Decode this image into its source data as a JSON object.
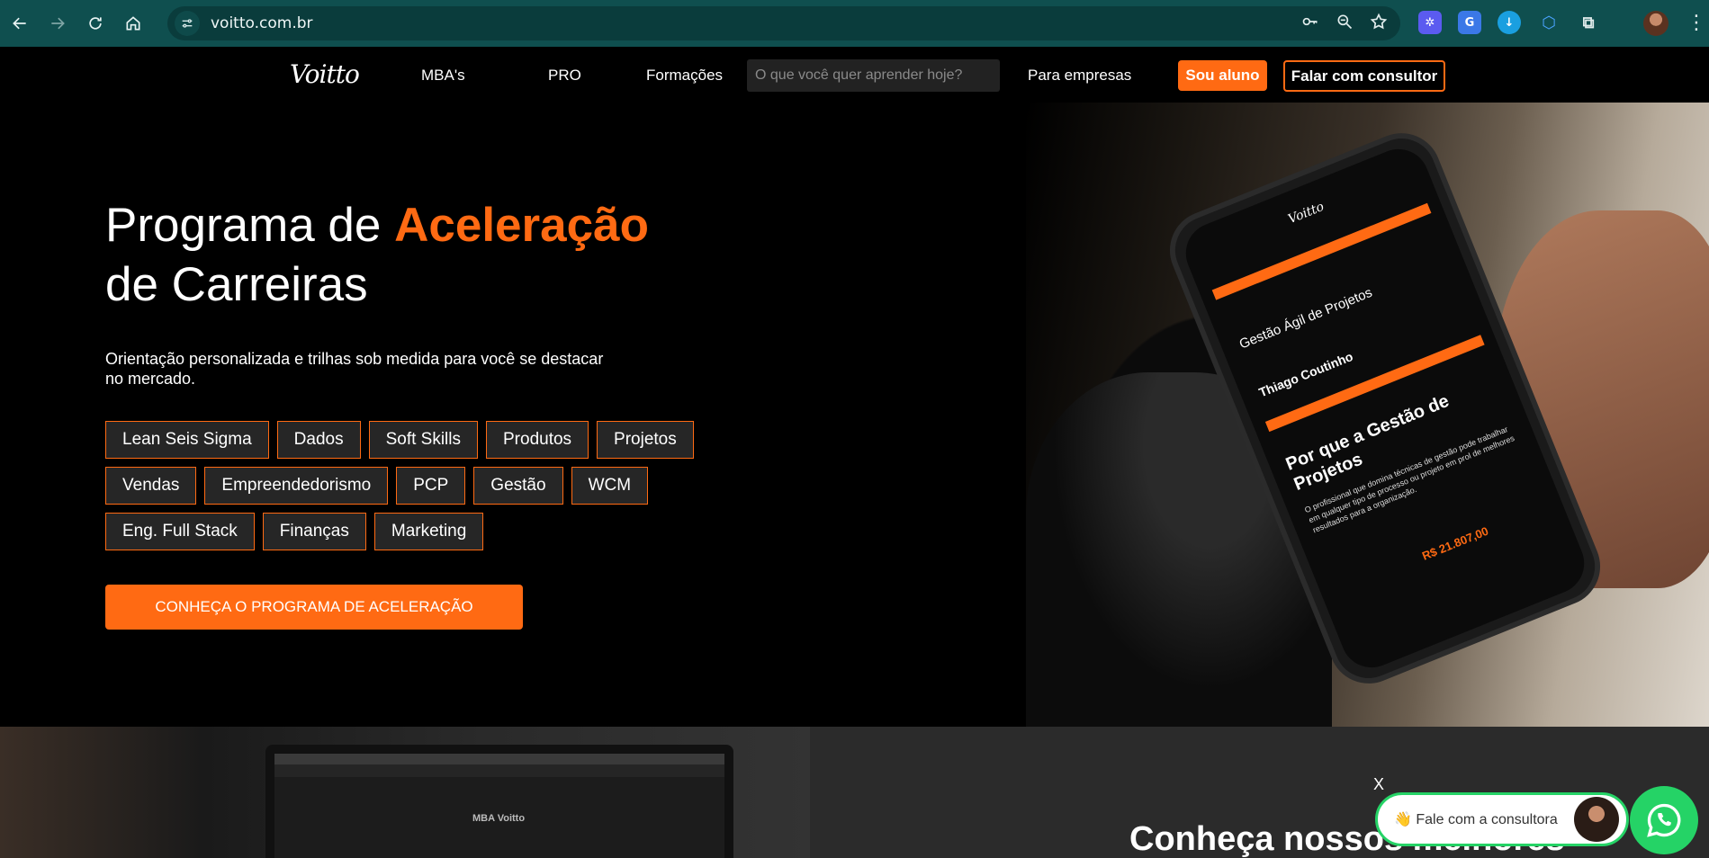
{
  "browser": {
    "url": "voitto.com.br",
    "profile_icon": "profile-avatar"
  },
  "header": {
    "logo": "Voitto",
    "nav": [
      "MBA's",
      "PRO",
      "Formações"
    ],
    "search_placeholder": "O que você quer aprender hoje?",
    "para_empresas": "Para empresas",
    "sou_aluno": "Sou aluno",
    "falar_consultor": "Falar com consultor"
  },
  "hero": {
    "title_part1": "Programa de ",
    "title_accent": "Aceleração",
    "title_part2": "de Carreiras",
    "subtitle": "Orientação personalizada e trilhas sob medida para você se destacar no mercado.",
    "tags": [
      [
        "Lean Seis Sigma",
        "Dados",
        "Soft Skills",
        "Produtos",
        "Projetos"
      ],
      [
        "Vendas",
        "Empreendedorismo",
        "PCP",
        "Gestão",
        "WCM"
      ],
      [
        "Eng. Full Stack",
        "Finanças",
        "Marketing"
      ]
    ],
    "cta": "CONHEÇA O PROGRAMA DE ACELERAÇÃO",
    "phone": {
      "logo": "Voitto",
      "course": "Gestão Ágil de Projetos",
      "coordinator": "Thiago Coutinho",
      "heading": "Por que a Gestão de Projetos",
      "body": "O profissional que domina técnicas de gestão pode trabalhar em qualquer tipo de processo ou projeto em prol de melhores resultados para a organização.",
      "price": "R$ 21.807,00"
    }
  },
  "lower": {
    "laptop_text": "MBA Voitto",
    "heading": "Conheça nossos melhores"
  },
  "chat": {
    "close": "X",
    "label": "👋 Fale com a consultora"
  },
  "colors": {
    "accent": "#ff6a13",
    "whatsapp": "#25d366",
    "chrome": "#0f4f4f"
  }
}
